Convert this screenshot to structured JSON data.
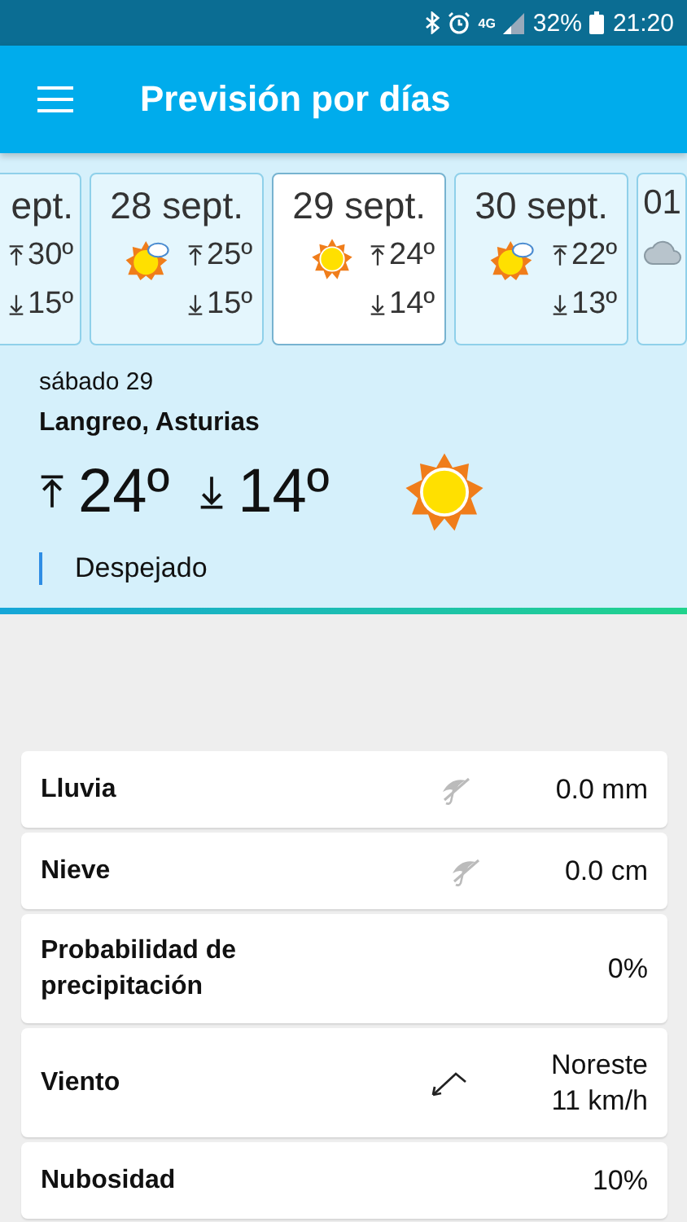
{
  "status_bar": {
    "battery": "32%",
    "time": "21:20",
    "network": "4G"
  },
  "app_bar": {
    "title": "Previsión por días"
  },
  "days": [
    {
      "date": "ept.",
      "high": "30º",
      "low": "15º",
      "selected": false
    },
    {
      "date": "28 sept.",
      "kind": "partly",
      "high": "25º",
      "low": "15º",
      "selected": false
    },
    {
      "date": "29 sept.",
      "kind": "sun",
      "high": "24º",
      "low": "14º",
      "selected": true
    },
    {
      "date": "30 sept.",
      "kind": "partly",
      "high": "22º",
      "low": "13º",
      "selected": false
    },
    {
      "date": "01",
      "kind": "cloud",
      "selected": false
    }
  ],
  "summary": {
    "day": "sábado 29",
    "place": "Langreo, Asturias",
    "high": "24º",
    "low": "14º",
    "kind": "sun",
    "condition": "Despejado"
  },
  "details": [
    {
      "label": "Lluvia",
      "kind": "umbrella-off",
      "value": [
        "0.0 mm"
      ]
    },
    {
      "label": "Nieve",
      "kind": "umbrella-off",
      "value": [
        "0.0 cm"
      ]
    },
    {
      "label": "Probabilidad de precipitación",
      "value": [
        "0%"
      ]
    },
    {
      "label": "Viento",
      "kind": "wind",
      "value": [
        "Noreste",
        "11 km/h"
      ]
    },
    {
      "label": "Nubosidad",
      "value": [
        "10%"
      ]
    }
  ]
}
